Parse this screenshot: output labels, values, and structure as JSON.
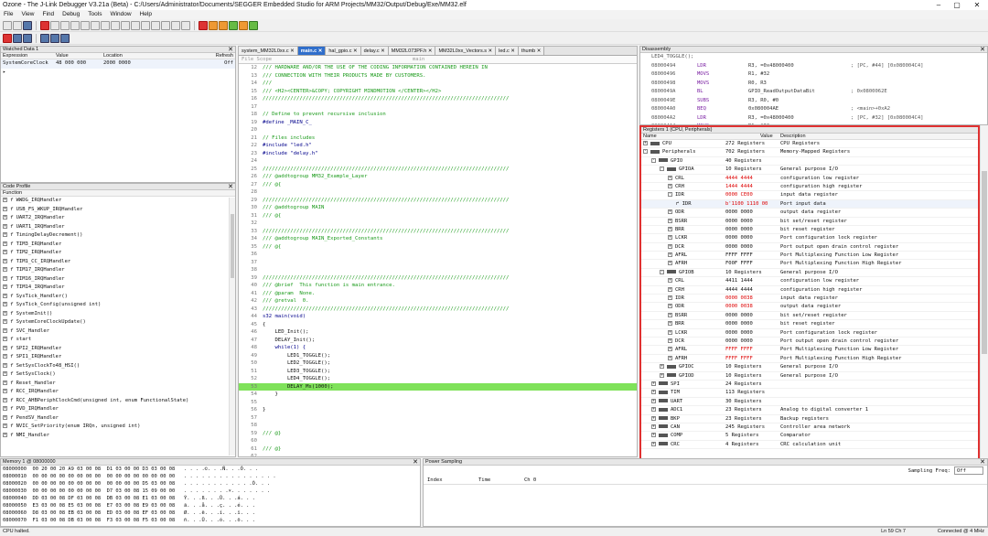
{
  "window": {
    "title": "Ozone - The J-Link Debugger V3.21a (Beta) - C:/Users/Administrator/Documents/SEGGER Embedded Studio for ARM Projects/MM32/Output/Debug/Exe/MM32.elf"
  },
  "menu": [
    "File",
    "View",
    "Find",
    "Debug",
    "Tools",
    "Window",
    "Help"
  ],
  "watched": {
    "title": "Watched Data 1",
    "cols": [
      "Expression",
      "Value",
      "Location",
      "Refresh"
    ],
    "row": {
      "expr": "SystemCoreClock",
      "value": "48 000 000",
      "location": "2000 0000",
      "refresh": "Off"
    }
  },
  "profile": {
    "title": "Code Profile",
    "col": "Function",
    "items": [
      "WWDG_IRQHandler",
      "USB_FS_WKUP_IRQHandler",
      "UART2_IRQHandler",
      "UART1_IRQHandler",
      "TimingDelayDecrement()",
      "TIM3_IRQHandler",
      "TIM2_IRQHandler",
      "TIM1_CC_IRQHandler",
      "TIM17_IRQHandler",
      "TIM16_IRQHandler",
      "TIM14_IRQHandler",
      "SysTick_Handler()",
      "SysTick_Config(unsigned int)",
      "SystemInit()",
      "SystemCoreClockUpdate()",
      "SVC_Handler",
      "start",
      "SPI2_IRQHandler",
      "SPI1_IRQHandler",
      "SetSysClockTo48_HSI()",
      "SetSysClock()",
      "Reset_Handler",
      "RCC_IRQHandler",
      "RCC_AHBPeriphClockCmd(unsigned int, enum FunctionalState)",
      "PVD_IRQHandler",
      "PendSV_Handler",
      "NVIC_SetPriority(enum IRQn, unsigned int)",
      "NMI_Handler"
    ]
  },
  "editor": {
    "tabs": [
      "system_MM32L0xx.c",
      "main.c",
      "hal_gpio.c",
      "delay.c",
      "MM32L073PF.h",
      "MM32L0xx_Vectors.s",
      "led.c",
      "thumb"
    ],
    "active_tab": "main.c",
    "scope_placeholder": "File Scope",
    "func_box": "main",
    "lines": [
      {
        "n": "12",
        "t": "/// HARDWARE AND/OR THE USE OF THE CODING INFORMATION CONTAINED HEREIN IN",
        "c": "cm"
      },
      {
        "n": "13",
        "t": "/// CONNECTION WITH THEIR PRODUCTS MADE BY CUSTOMERS.",
        "c": "cm"
      },
      {
        "n": "14",
        "t": "///",
        "c": "cm"
      },
      {
        "n": "15",
        "t": "/// <H2><CENTER>&COPY; COPYRIGHT MINDMOTION </CENTER></H2>",
        "c": "cm"
      },
      {
        "n": "16",
        "t": "////////////////////////////////////////////////////////////////////////////////",
        "c": "cm"
      },
      {
        "n": "17",
        "t": "",
        "c": ""
      },
      {
        "n": "18",
        "t": "// Define to prevent recursive inclusion",
        "c": "cm"
      },
      {
        "n": "19",
        "t": "#define _MAIN_C_",
        "c": "kw"
      },
      {
        "n": "20",
        "t": "",
        "c": ""
      },
      {
        "n": "21",
        "t": "// Files includes",
        "c": "cm"
      },
      {
        "n": "22",
        "t": "#include \"led.h\"",
        "c": "kw"
      },
      {
        "n": "23",
        "t": "#include \"delay.h\"",
        "c": "kw"
      },
      {
        "n": "24",
        "t": "",
        "c": ""
      },
      {
        "n": "25",
        "t": "////////////////////////////////////////////////////////////////////////////////",
        "c": "cm"
      },
      {
        "n": "26",
        "t": "/// @addtogroup MM32_Example_Layer",
        "c": "cm"
      },
      {
        "n": "27",
        "t": "/// @{",
        "c": "cm"
      },
      {
        "n": "28",
        "t": "",
        "c": ""
      },
      {
        "n": "29",
        "t": "////////////////////////////////////////////////////////////////////////////////",
        "c": "cm"
      },
      {
        "n": "30",
        "t": "/// @addtogroup MAIN",
        "c": "cm"
      },
      {
        "n": "31",
        "t": "/// @{",
        "c": "cm"
      },
      {
        "n": "32",
        "t": "",
        "c": ""
      },
      {
        "n": "33",
        "t": "////////////////////////////////////////////////////////////////////////////////",
        "c": "cm"
      },
      {
        "n": "34",
        "t": "/// @addtogroup MAIN_Exported_Constants",
        "c": "cm"
      },
      {
        "n": "35",
        "t": "/// @{",
        "c": "cm"
      },
      {
        "n": "36",
        "t": "",
        "c": ""
      },
      {
        "n": "37",
        "t": "",
        "c": ""
      },
      {
        "n": "38",
        "t": "",
        "c": ""
      },
      {
        "n": "39",
        "t": "////////////////////////////////////////////////////////////////////////////////",
        "c": "cm"
      },
      {
        "n": "40",
        "t": "/// @brief  This function is main entrance.",
        "c": "cm"
      },
      {
        "n": "41",
        "t": "/// @param  None.",
        "c": "cm"
      },
      {
        "n": "42",
        "t": "/// @retval  0.",
        "c": "cm"
      },
      {
        "n": "43",
        "t": "////////////////////////////////////////////////////////////////////////////////",
        "c": "cm"
      },
      {
        "n": "44",
        "t": "s32 main(void)",
        "c": "kw"
      },
      {
        "n": "45",
        "t": "{",
        "c": ""
      },
      {
        "n": "46",
        "t": "    LED_Init();",
        "c": ""
      },
      {
        "n": "47",
        "t": "    DELAY_Init();",
        "c": ""
      },
      {
        "n": "48",
        "t": "    while(1) {",
        "c": "kw"
      },
      {
        "n": "49",
        "t": "        LED1_TOGGLE();",
        "c": ""
      },
      {
        "n": "50",
        "t": "        LED2_TOGGLE();",
        "c": ""
      },
      {
        "n": "51",
        "t": "        LED3_TOGGLE();",
        "c": ""
      },
      {
        "n": "52",
        "t": "        LED4_TOGGLE();",
        "c": ""
      },
      {
        "n": "53",
        "t": "        DELAY_Ms(1000);",
        "c": "hl"
      },
      {
        "n": "54",
        "t": "    }",
        "c": ""
      },
      {
        "n": "55",
        "t": "",
        "c": ""
      },
      {
        "n": "56",
        "t": "}",
        "c": ""
      },
      {
        "n": "57",
        "t": "",
        "c": ""
      },
      {
        "n": "58",
        "t": "",
        "c": ""
      },
      {
        "n": "59",
        "t": "/// @}",
        "c": "cm"
      },
      {
        "n": "60",
        "t": "",
        "c": ""
      },
      {
        "n": "61",
        "t": "/// @}",
        "c": "cm"
      },
      {
        "n": "62",
        "t": "",
        "c": ""
      },
      {
        "n": "63",
        "t": "/// @}",
        "c": "cm"
      },
      {
        "n": "64",
        "t": "",
        "c": ""
      }
    ]
  },
  "disasm": {
    "title": "Disassembly",
    "first": "LED4_TOGGLE();",
    "rows": [
      {
        "a": "08000494",
        "m": "LDR",
        "o": "R3, =0x48000400",
        "c": "; [PC, #44] [0x080004C4]"
      },
      {
        "a": "08000496",
        "m": "MOVS",
        "o": "R1, #32",
        "c": ""
      },
      {
        "a": "08000498",
        "m": "MOVS",
        "o": "R0, R3",
        "c": ""
      },
      {
        "a": "0800049A",
        "m": "BL",
        "o": "GPIO_ReadOutputDataBit",
        "c": "; 0x0800062E"
      },
      {
        "a": "0800049E",
        "m": "SUBS",
        "o": "R3, R0, #0",
        "c": ""
      },
      {
        "a": "080004A0",
        "m": "BEQ",
        "o": "0x080004AE",
        "c": "; <main>+0xA2"
      },
      {
        "a": "080004A2",
        "m": "LDR",
        "o": "R3, =0x48000400",
        "c": "; [PC, #32] [0x080004C4]"
      },
      {
        "a": "080004A4",
        "m": "MOVS",
        "o": "R1, #32",
        "c": ""
      }
    ]
  },
  "registers": {
    "title": "Registers 1 (CPU, Peripherals)",
    "cols": [
      "Name",
      "Value",
      "Description"
    ],
    "rows": [
      {
        "d": 0,
        "n": "CPU",
        "v": "272 Registers",
        "desc": "CPU Registers",
        "r": false,
        "e": "+"
      },
      {
        "d": 0,
        "n": "Peripherals",
        "v": "702 Registers",
        "desc": "Memory-Mapped Registers",
        "r": false,
        "e": "-"
      },
      {
        "d": 1,
        "n": "GPIO",
        "v": "40 Registers",
        "desc": "",
        "r": false,
        "e": "-"
      },
      {
        "d": 2,
        "n": "GPIOA",
        "v": "10 Registers",
        "desc": "General purpose I/O",
        "r": false,
        "e": "-"
      },
      {
        "d": 3,
        "n": "CRL",
        "v": "4444 4444",
        "desc": "configuration low register",
        "r": true,
        "e": "+"
      },
      {
        "d": 3,
        "n": "CRH",
        "v": "1444 4444",
        "desc": "configuration high register",
        "r": true,
        "e": "+"
      },
      {
        "d": 3,
        "n": "IDR",
        "v": "0000 CE00",
        "desc": "input data register",
        "r": true,
        "e": "-"
      },
      {
        "d": 4,
        "n": "IDR",
        "v": "b'1100 1110 00",
        "desc": "Port input data",
        "r": true,
        "e": ""
      },
      {
        "d": 3,
        "n": "ODR",
        "v": "0000 0000",
        "desc": "output data register",
        "r": false,
        "e": "+"
      },
      {
        "d": 3,
        "n": "BSRR",
        "v": "0000 0000",
        "desc": "bit set/reset register",
        "r": false,
        "e": "+"
      },
      {
        "d": 3,
        "n": "BRR",
        "v": "0000 0000",
        "desc": "bit reset register",
        "r": false,
        "e": "+"
      },
      {
        "d": 3,
        "n": "LCKR",
        "v": "0000 0000",
        "desc": "Port configuration lock register",
        "r": false,
        "e": "+"
      },
      {
        "d": 3,
        "n": "DCR",
        "v": "0000 0000",
        "desc": "Port output open drain control register",
        "r": false,
        "e": "+"
      },
      {
        "d": 3,
        "n": "AFRL",
        "v": "FFFF FFFF",
        "desc": "Port Multiplexing Function Low Register",
        "r": false,
        "e": "+"
      },
      {
        "d": 3,
        "n": "AFRH",
        "v": "F00F FFFF",
        "desc": "Port Multiplexing Function High Register",
        "r": false,
        "e": "+"
      },
      {
        "d": 2,
        "n": "GPIOB",
        "v": "10 Registers",
        "desc": "General purpose I/O",
        "r": false,
        "e": "-"
      },
      {
        "d": 3,
        "n": "CRL",
        "v": "4411 1444",
        "desc": "configuration low register",
        "r": false,
        "e": "+"
      },
      {
        "d": 3,
        "n": "CRH",
        "v": "4444 4444",
        "desc": "configuration high register",
        "r": false,
        "e": "+"
      },
      {
        "d": 3,
        "n": "IDR",
        "v": "0000 0038",
        "desc": "input data register",
        "r": true,
        "e": "+"
      },
      {
        "d": 3,
        "n": "ODR",
        "v": "0000 0038",
        "desc": "output data register",
        "r": true,
        "e": "+"
      },
      {
        "d": 3,
        "n": "BSRR",
        "v": "0000 0000",
        "desc": "bit set/reset register",
        "r": false,
        "e": "+"
      },
      {
        "d": 3,
        "n": "BRR",
        "v": "0000 0000",
        "desc": "bit reset register",
        "r": false,
        "e": "+"
      },
      {
        "d": 3,
        "n": "LCKR",
        "v": "0000 0000",
        "desc": "Port configuration lock register",
        "r": false,
        "e": "+"
      },
      {
        "d": 3,
        "n": "DCR",
        "v": "0000 0000",
        "desc": "Port output open drain control register",
        "r": false,
        "e": "+"
      },
      {
        "d": 3,
        "n": "AFRL",
        "v": "FFFF FFFF",
        "desc": "Port Multiplexing Function Low Register",
        "r": true,
        "e": "+"
      },
      {
        "d": 3,
        "n": "AFRH",
        "v": "FFFF FFFF",
        "desc": "Port Multiplexing Function High Register",
        "r": true,
        "e": "+"
      },
      {
        "d": 2,
        "n": "GPIOC",
        "v": "10 Registers",
        "desc": "General purpose I/O",
        "r": false,
        "e": "+"
      },
      {
        "d": 2,
        "n": "GPIOD",
        "v": "10 Registers",
        "desc": "General purpose I/O",
        "r": false,
        "e": "+"
      },
      {
        "d": 1,
        "n": "SPI",
        "v": "24 Registers",
        "desc": "",
        "r": false,
        "e": "+"
      },
      {
        "d": 1,
        "n": "TIM",
        "v": "113 Registers",
        "desc": "",
        "r": false,
        "e": "+"
      },
      {
        "d": 1,
        "n": "UART",
        "v": "30 Registers",
        "desc": "",
        "r": false,
        "e": "+"
      },
      {
        "d": 1,
        "n": "ADC1",
        "v": "23 Registers",
        "desc": "Analog to digital converter 1",
        "r": false,
        "e": "+"
      },
      {
        "d": 1,
        "n": "BKP",
        "v": "23 Registers",
        "desc": "Backup registers",
        "r": false,
        "e": "+"
      },
      {
        "d": 1,
        "n": "CAN",
        "v": "245 Registers",
        "desc": "Controller area network",
        "r": false,
        "e": "+"
      },
      {
        "d": 1,
        "n": "COMP",
        "v": "5 Registers",
        "desc": "Comparator",
        "r": false,
        "e": "+"
      },
      {
        "d": 1,
        "n": "CRC",
        "v": "4 Registers",
        "desc": "CRC calculation unit",
        "r": false,
        "e": "+"
      }
    ]
  },
  "memory": {
    "title": "Memory 1 @ 08000000",
    "rows": [
      "08000000  00 20 00 20 A9 03 00 08  D1 03 00 00 D3 03 00 08   . . . .©. . .Ñ. . .Ó. . .",
      "08000010  00 00 00 00 00 00 00 00  00 00 00 00 00 00 00 00   . . . . . . . . . . . . . . . .",
      "08000020  00 00 00 00 00 00 00 00  00 00 00 00 D5 03 00 08   . . . . . . . . . . . .Õ. . .",
      "08000030  00 00 00 00 00 00 00 00  D7 03 00 08 15 09 00 00   . . . . . . . .×. . . . . . .",
      "08000040  DD 03 00 08 DF 03 00 08  DB 03 00 08 E1 03 00 08   Ý. . .ß. . .Û. . .á. . .",
      "08000050  E3 03 00 08 E5 03 00 08  E7 03 00 08 E9 03 00 08   ã. . .å. . .ç. . .é. . .",
      "08000060  D8 03 00 08 EB 03 00 08  ED 03 00 08 EF 03 00 08   Ø. . .ë. . .í. . .ï. . .",
      "08000070  F1 03 00 08 DB 03 00 08  F3 03 00 08 F5 03 00 08   ñ. . .Û. . .ó. . .õ. . ."
    ]
  },
  "power": {
    "title": "Power Sampling",
    "freq_label": "Sampling Freq:",
    "freq_value": "Off",
    "cols": [
      "Index",
      "Time",
      "Ch 0"
    ]
  },
  "status": {
    "left": "CPU halted.",
    "pos": "Ln 59  Ch 7",
    "conn": "Connected @ 4 MHz"
  },
  "colors": {
    "active_tab": "#2f6ecb",
    "highlight": "#7fe25a",
    "register_box": "#e03030"
  }
}
